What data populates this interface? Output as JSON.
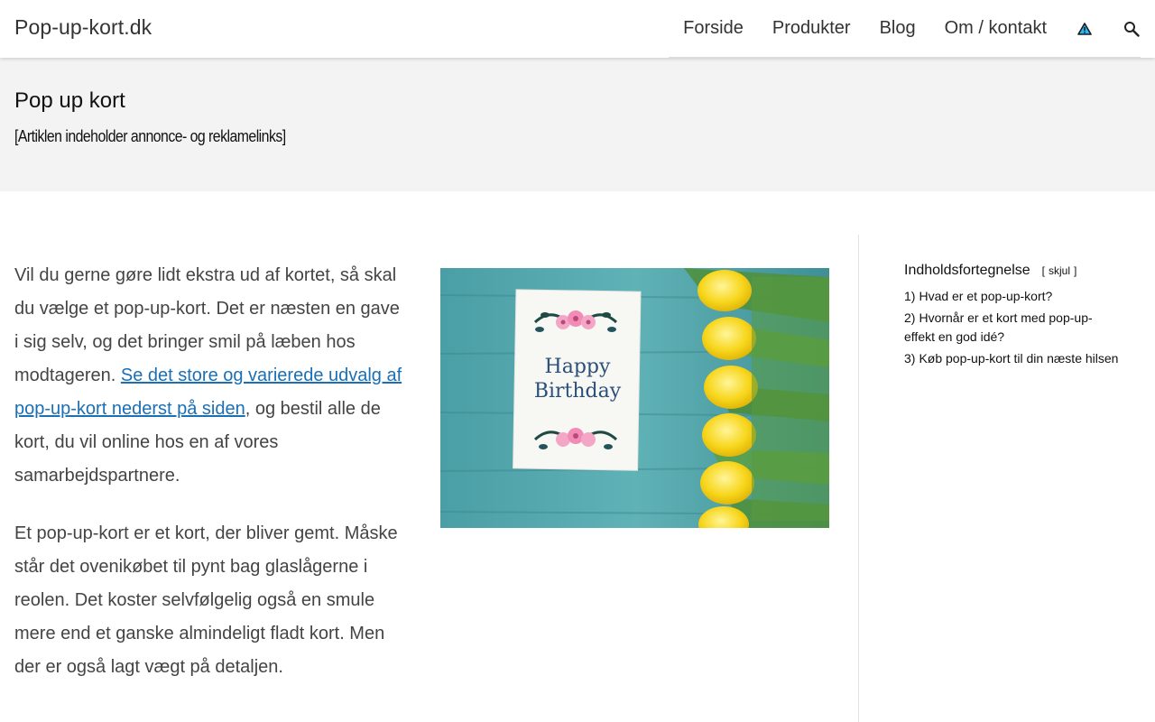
{
  "header": {
    "site_title": "Pop-up-kort.dk",
    "nav": {
      "home": "Forside",
      "products": "Produkter",
      "blog": "Blog",
      "about": "Om / kontakt"
    },
    "icons": [
      "warning-triangle-icon",
      "search-icon"
    ]
  },
  "hero": {
    "title": "Pop up kort",
    "disclaimer": "[Artiklen indeholder annonce- og reklamelinks]"
  },
  "article": {
    "p1_before": "Vil du gerne gøre lidt ekstra ud af kortet, så skal du vælge et pop-up-kort. Det er næsten en gave i sig selv, og det bringer smil på læben hos modtageren. ",
    "p1_link": "Se det store og varierede udvalg af pop-up-kort nederst på siden",
    "p1_after": ", og bestil alle de kort, du vil online hos en af vores samarbejdspartnere.",
    "p2": "Et pop-up-kort er et kort, der bliver gemt. Måske står det ovenikøbet til pynt bag glaslågerne i reolen. Det koster selvfølgelig også en smule mere end et ganske almindeligt fladt kort. Men der er også lagt vægt på detaljen.",
    "image": {
      "card_line1": "Happy",
      "card_line2": "Birthday"
    }
  },
  "toc": {
    "title": "Indholdsfortegnelse",
    "toggle_open": "[",
    "toggle_label": "skjul",
    "toggle_close": "]",
    "items": [
      {
        "num": "1)",
        "label": "Hvad er et pop-up-kort?"
      },
      {
        "num": "2)",
        "label": "Hvornår er et kort med pop-up-effekt en god idé?"
      },
      {
        "num": "3)",
        "label": "Køb pop-up-kort til din næste hilsen"
      }
    ]
  },
  "colors": {
    "link": "#1a6fb5",
    "hero_bg": "#f3f3f3",
    "text": "#444444"
  }
}
